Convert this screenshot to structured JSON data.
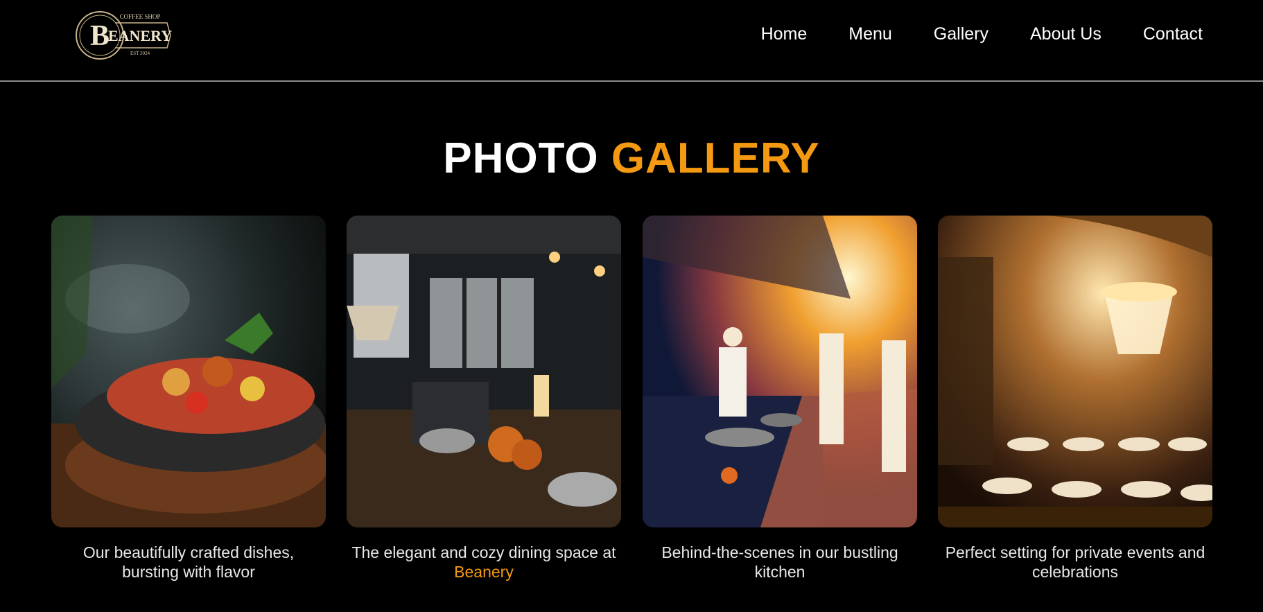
{
  "logo": {
    "top_text": "COFFEE SHOP",
    "letter": "B",
    "name": "EANERY",
    "est": "EST 2024"
  },
  "nav": {
    "items": [
      "Home",
      "Menu",
      "Gallery",
      "About Us",
      "Contact"
    ]
  },
  "title": {
    "part1": "PHOTO",
    "part2": "GALLERY"
  },
  "gallery": [
    {
      "caption": "Our beautifully crafted dishes, bursting with flavor",
      "icon": "food-dish-image"
    },
    {
      "caption_prefix": "The elegant and cozy dining space at ",
      "caption_accent": "Beanery",
      "icon": "dining-room-image"
    },
    {
      "caption": "Behind-the-scenes in our bustling kitchen",
      "icon": "kitchen-image"
    },
    {
      "caption": "Perfect setting for private events and celebrations",
      "icon": "banquet-hall-image"
    }
  ],
  "colors": {
    "accent": "#f49a12",
    "background": "#000000",
    "text": "#ffffff"
  }
}
